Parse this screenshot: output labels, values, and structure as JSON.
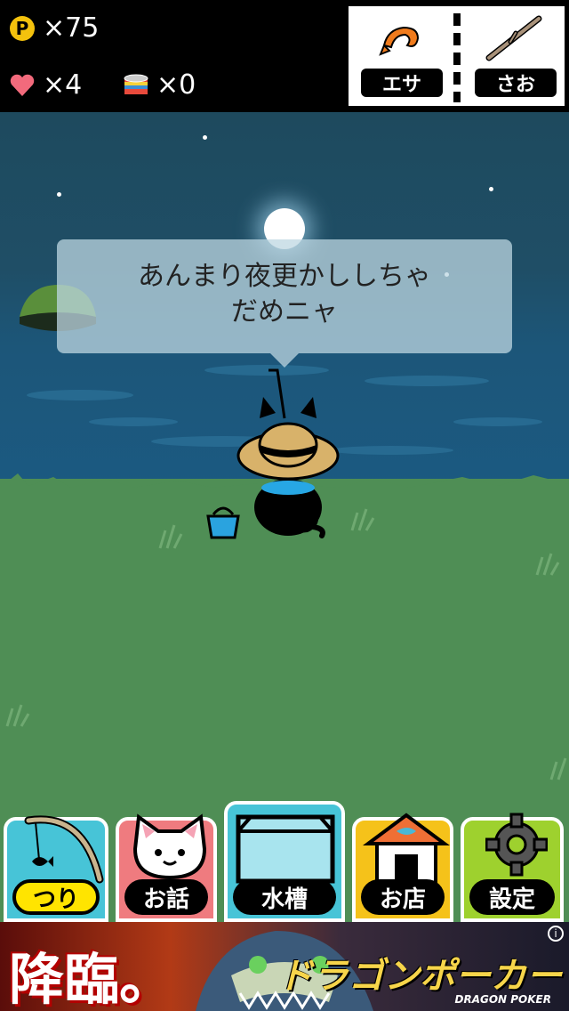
{
  "hud": {
    "points": "×75",
    "hearts": "×4",
    "cans": "×0",
    "coin_glyph": "P",
    "icons": [
      "coin-icon",
      "heart-icon",
      "cat-food-can-icon"
    ]
  },
  "equipment": {
    "bait_label": "エサ",
    "rod_label": "さお"
  },
  "dialogue": {
    "line1": "あんまり夜更かししちゃ",
    "line2": "だめニャ"
  },
  "tabs": [
    {
      "label": "つり",
      "icon": "fishing-rod-icon",
      "active": true
    },
    {
      "label": "お話",
      "icon": "cat-face-icon",
      "active": false
    },
    {
      "label": "水槽",
      "icon": "aquarium-icon",
      "active": false
    },
    {
      "label": "お店",
      "icon": "shop-icon",
      "active": false
    },
    {
      "label": "設定",
      "icon": "gear-icon",
      "active": false
    }
  ],
  "ad": {
    "headline": "降臨。",
    "logo": "ドラゴンポーカー",
    "logo_sub": "DRAGON POKER",
    "info_glyph": "i"
  },
  "colors": {
    "tab_fishing": "#47c4d7",
    "tab_talk": "#ef7b7f",
    "tab_aquarium": "#47c4d7",
    "tab_shop": "#f5c21a",
    "tab_settings": "#9ed12e",
    "grass": "#4f8e55",
    "sea": "#1c5679"
  }
}
